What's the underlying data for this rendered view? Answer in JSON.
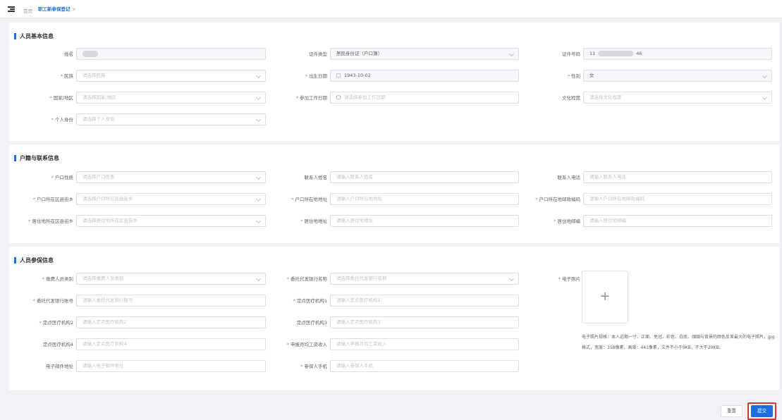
{
  "breadcrumb": {
    "home": "首页",
    "active_tab": "职工新参保登记",
    "close": "×"
  },
  "sections": {
    "basic": {
      "title": "人员基本信息",
      "name_label": "姓名",
      "id_type_label": "证件类型",
      "id_type_value": "居民身份证（户口簿）",
      "id_no_label": "证件号码",
      "id_no_prefix": "11",
      "id_no_suffix": "46",
      "ethnic_label": "民族",
      "ethnic_placeholder": "请选择民族",
      "birth_label": "出生日期",
      "birth_value": "1943-10-02",
      "gender_label": "性别",
      "gender_value": "女",
      "country_label": "国家/地区",
      "country_placeholder": "请选择国家/地区",
      "workdate_label": "参加工作日期",
      "workdate_placeholder": "请选择参加工作日期",
      "edu_label": "文化程度",
      "edu_placeholder": "请选择文化程度",
      "identity_label": "个人身份",
      "identity_placeholder": "请选择个人身份"
    },
    "household": {
      "title": "户籍与联系信息",
      "hukou_type_label": "户口性质",
      "hukou_type_placeholder": "请选择户口性质",
      "contact_name_label": "联系人姓名",
      "contact_name_placeholder": "请输入联系人姓名",
      "contact_phone_label": "联系人电话",
      "contact_phone_placeholder": "请输入联系人电话",
      "hukou_area_label": "户口所在区县街乡",
      "hukou_area_placeholder": "请选择户口所在区县街乡",
      "hukou_addr_label": "户口所在地地址",
      "hukou_addr_placeholder": "请输入户口所在地地址",
      "hukou_zip_label": "户口所在地邮政编码",
      "hukou_zip_placeholder": "请输入户口所在地邮政编码",
      "res_area_label": "居住地所在区县街乡",
      "res_area_placeholder": "请选择居住地所在区县街乡",
      "res_addr_label": "居住地地址",
      "res_addr_placeholder": "请输入居住地地址",
      "res_zip_label": "居住地邮编",
      "res_zip_placeholder": "请输入居住地邮编"
    },
    "insurance": {
      "title": "人员参保信息",
      "emp_type_label": "缴费人员类别",
      "emp_type_placeholder": "请选择缴费人员类别",
      "bank_label": "委托代发银行名称",
      "bank_placeholder": "请选择委托代发银行名称",
      "photo_label": "电子照片",
      "bank_acct_label": "委托代发银行账号",
      "bank_acct_placeholder": "请输入委托代发银行账号",
      "hosp1_label": "定点医疗机构1",
      "hosp1_placeholder": "请输入定点医疗机构1",
      "hosp2_label": "定点医疗机构2",
      "hosp2_placeholder": "请输入定点医疗机构2",
      "hosp3_label": "定点医疗机构3",
      "hosp3_placeholder": "请输入定点医疗机构3",
      "hosp4_label": "定点医疗机构4",
      "hosp4_placeholder": "请输入定点医疗机构4",
      "income_label": "申报月均工资收入",
      "income_placeholder": "请输入申报月均工资收入",
      "email_label": "电子邮件地址",
      "email_placeholder": "请输入电子邮件地址",
      "mobile_label": "参保人手机",
      "mobile_placeholder": "请输入参保人手机",
      "photo_hint": "电子照片规格：本人近期一寸、正面、免冠、彩色、白底、頭頸与背景的颜色反差最大的电子照片，jpg格式，宽度：358像素，高度：441像素，文件不小于9KB，不大于20KB。"
    }
  },
  "buttons": {
    "reset": "重置",
    "submit": "提交"
  },
  "icons": {
    "menu": "menu-fold-icon",
    "plus": "+"
  },
  "colors": {
    "primary": "#1e6ee0",
    "required": "#f56c6c",
    "highlight": "#e0322b"
  }
}
